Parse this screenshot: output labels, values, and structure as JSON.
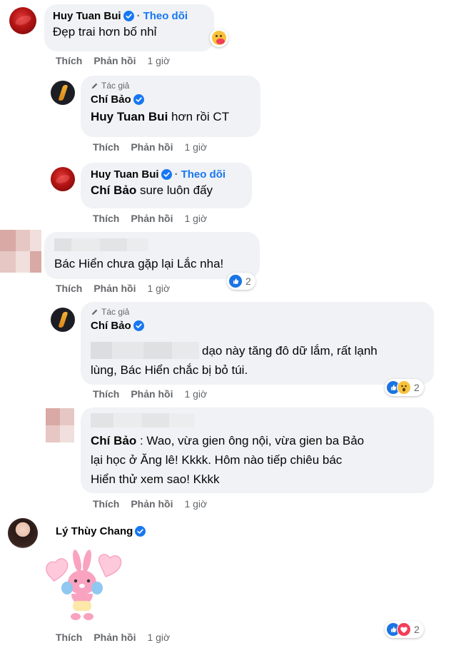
{
  "colors": {
    "bubble": "#f0f2f5",
    "link": "#1877f2",
    "muted": "#65676b",
    "like": "#1b74e4",
    "love": "#f33e58",
    "wow": "#f7c23c"
  },
  "labels": {
    "like": "Thích",
    "reply": "Phản hồi",
    "follow": "Theo dõi",
    "author": "Tác giả",
    "separator": "·"
  },
  "comments": [
    {
      "name": "Huy Tuan Bui",
      "text": "Đẹp trai hơn bố nhỉ",
      "time": "1 giờ",
      "reaction": "care-emoji"
    },
    {
      "name": "Chí Bảo",
      "mention": "Huy Tuan Bui",
      "text": "hơn rồi CT",
      "time": "1 giờ"
    },
    {
      "name": "Huy Tuan Bui",
      "mention": "Chí Bảo",
      "text": "sure luôn đấy",
      "time": "1 giờ"
    },
    {
      "name": "",
      "text": "Bác Hiển chưa gặp lại Lắc nha!",
      "time": "1 giờ",
      "reactions": [
        "like-icon"
      ],
      "reaction_count": "2"
    },
    {
      "name": "Chí Bảo",
      "text_line1": "dạo này tăng đô dữ lắm, rất lạnh",
      "text_line2": "lùng, Bác Hiển chắc bị bỏ túi.",
      "time": "1 giờ",
      "reactions": [
        "like-icon",
        "wow-icon"
      ],
      "reaction_count": "2"
    },
    {
      "name": "",
      "mention": "Chí Bảo",
      "text_line1": ": Wao, vừa gien ông nội, vừa gien ba Bảo",
      "text_line2": "lại học ở Ăng lê! Kkkk. Hôm nào tiếp chiêu bác",
      "text_line3": "Hiển thử xem sao! Kkkk",
      "time": "1 giờ"
    },
    {
      "name": "Lý Thùy Chang",
      "sticker": "pink-bunny-sticker",
      "time": "1 giờ",
      "reactions": [
        "like-icon",
        "care-icon"
      ],
      "reaction_count": "2"
    }
  ]
}
